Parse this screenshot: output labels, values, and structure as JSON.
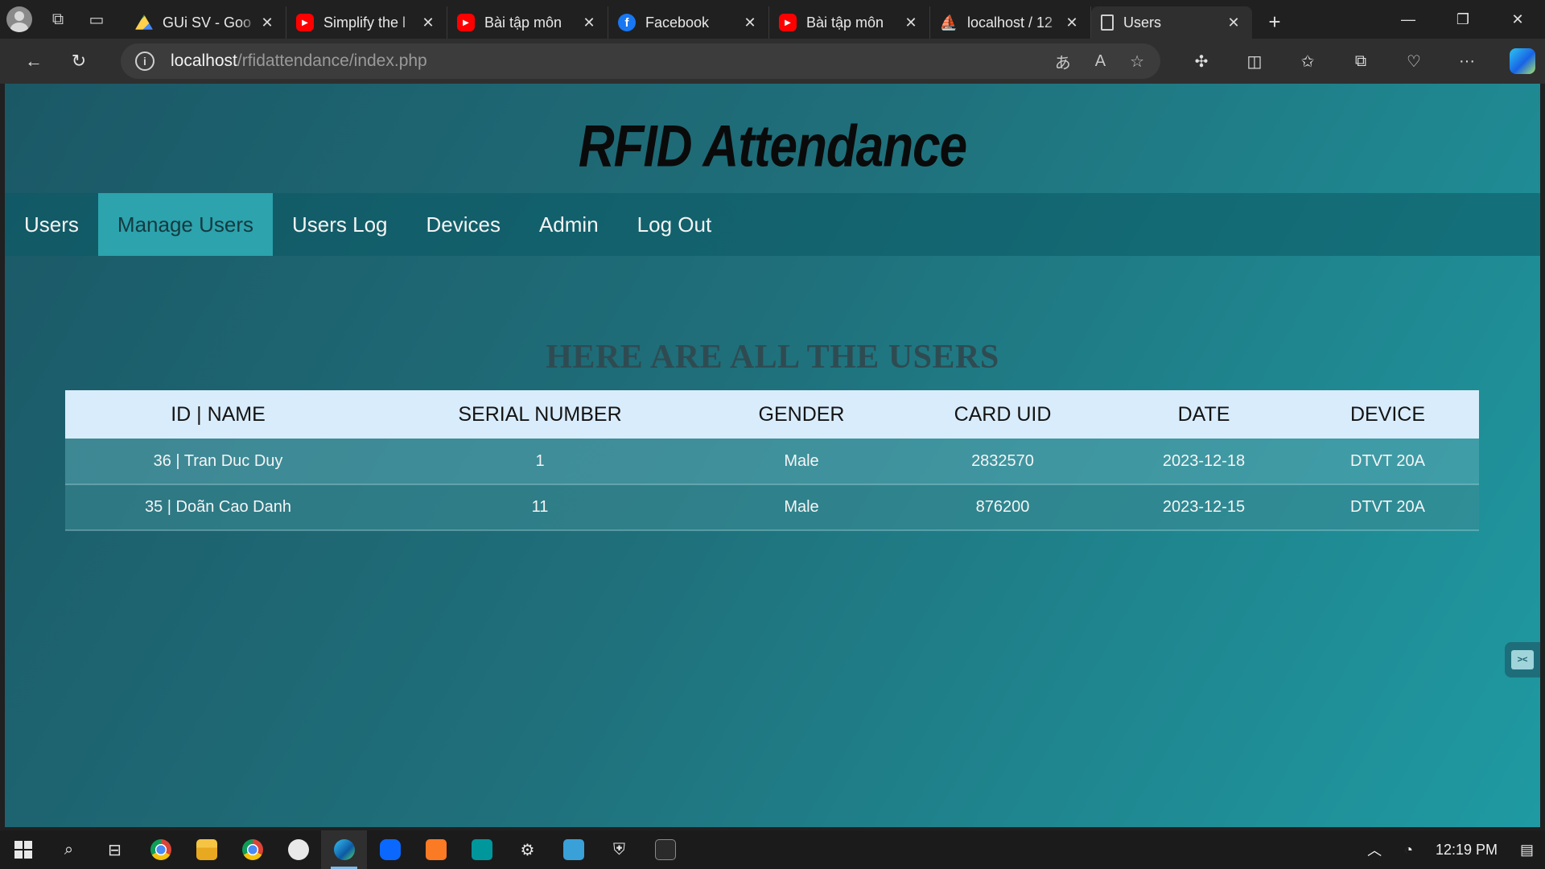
{
  "browser": {
    "tabs": [
      {
        "title": "GUi SV - Goo",
        "favicon": "google-drive-icon",
        "active": false
      },
      {
        "title": "Simplify the l",
        "favicon": "youtube-icon",
        "active": false
      },
      {
        "title": "Bài tập môn",
        "favicon": "youtube-icon",
        "active": false
      },
      {
        "title": "Facebook",
        "favicon": "facebook-icon",
        "active": false
      },
      {
        "title": "Bài tập môn",
        "favicon": "youtube-icon",
        "active": false
      },
      {
        "title": "localhost / 12",
        "favicon": "phpmyadmin-icon",
        "active": false
      },
      {
        "title": "Users",
        "favicon": "page-icon",
        "active": true
      }
    ],
    "address": {
      "host": "localhost",
      "path": "/rfidattendance/index.php"
    },
    "window_controls": [
      "minimize-icon",
      "restore-icon",
      "close-icon"
    ]
  },
  "site": {
    "title": "RFID Attendance",
    "nav": [
      {
        "label": "Users",
        "active": false
      },
      {
        "label": "Manage Users",
        "active": true
      },
      {
        "label": "Users Log",
        "active": false
      },
      {
        "label": "Devices",
        "active": false
      },
      {
        "label": "Admin",
        "active": false
      },
      {
        "label": "Log Out",
        "active": false
      }
    ],
    "section_title": "HERE ARE ALL THE USERS"
  },
  "table": {
    "headers": [
      "ID | NAME",
      "SERIAL NUMBER",
      "GENDER",
      "CARD UID",
      "DATE",
      "DEVICE"
    ],
    "rows": [
      [
        "36 | Tran Duc Duy",
        "1",
        "Male",
        "2832570",
        "2023-12-18",
        "DTVT 20A"
      ],
      [
        "35 | Doãn Cao Danh",
        "11",
        "Male",
        "876200",
        "2023-12-15",
        "DTVT 20A"
      ]
    ]
  },
  "taskbar": {
    "clock": "12:19 PM"
  },
  "colors": {
    "nav_active_bg": "#2ca3ad",
    "table_header_bg": "#d9ecfb",
    "page_gradient_start": "#1b5866",
    "page_gradient_end": "#1f9aa2"
  }
}
